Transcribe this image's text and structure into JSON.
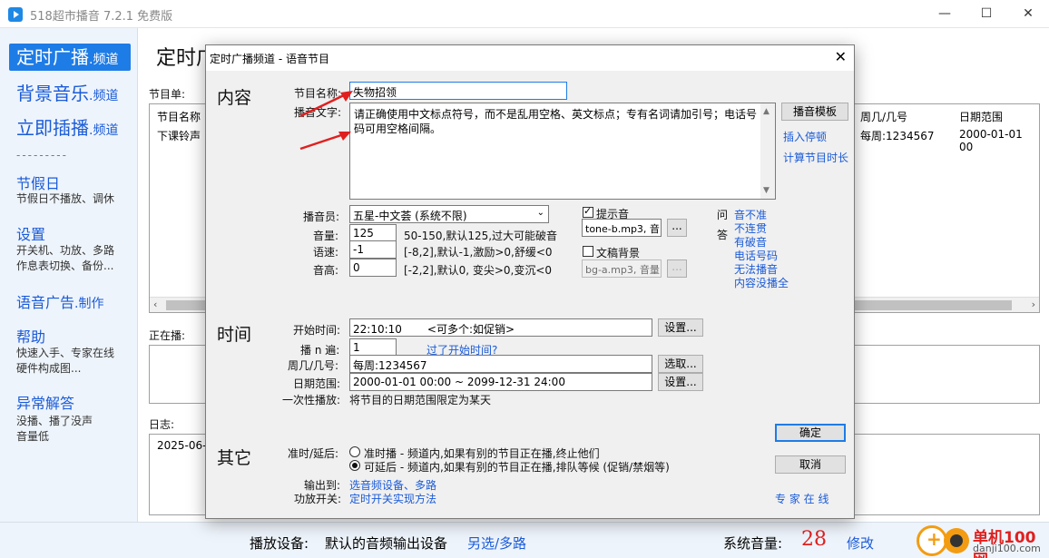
{
  "window": {
    "title": "518超市播音 7.2.1 免费版"
  },
  "sidebar": {
    "main_items": [
      {
        "label": "定时广播",
        "suffix": ".频道"
      },
      {
        "label": "背景音乐",
        "suffix": ".频道"
      },
      {
        "label": "立即插播",
        "suffix": ".频道"
      }
    ],
    "separator": "---------",
    "sections": [
      {
        "title": "节假日",
        "desc": [
          "节假日不播放、调休"
        ]
      },
      {
        "title": "设置",
        "desc": [
          "开关机、功放、多路",
          "作息表切换、备份..."
        ]
      },
      {
        "title": "语音广告",
        "title_suffix": ".制作",
        "desc": []
      },
      {
        "title": "帮助",
        "desc": [
          "快速入手、专家在线",
          "硬件构成图..."
        ]
      },
      {
        "title": "异常解答",
        "desc": [
          "没播、播了没声",
          "音量低"
        ]
      }
    ]
  },
  "main": {
    "page_title_partial": "定时广",
    "program_list_label": "节目单:",
    "columns": [
      "节目名称",
      "周几/几号",
      "日期范围"
    ],
    "row": {
      "name": "下课铃声",
      "weekday": "每周:1234567",
      "date_range": "2000-01-01 00"
    },
    "playing_label": "正在播:",
    "log_label": "日志:",
    "log_partial": "2025-06-"
  },
  "status_bar": {
    "device_label": "播放设备:",
    "device_value": "默认的音频输出设备",
    "device_link": "另选/多路",
    "volume_label": "系统音量:",
    "volume_value": "28",
    "modify_link": "修改"
  },
  "watermark": {
    "brand": "单机100网",
    "url": "danji100.com"
  },
  "dialog": {
    "title": "定时广播频道 - 语音节目",
    "close": "X",
    "section_content": "内容",
    "section_time": "时间",
    "section_other": "其它",
    "program_name_label": "节目名称:",
    "program_name_value": "失物招领",
    "text_label": "播音文字:",
    "text_value": "请正确使用中文标点符号，而不是乱用空格、英文标点；专有名词请加引号；电话号码可用空格间隔。",
    "template_button": "播音模板",
    "insert_pause_link": "插入停顿",
    "calc_duration_link": "计算节目时长",
    "announcer_label": "播音员:",
    "announcer_value": "五星-中文荟 (系统不限)",
    "volume_label": "音量:",
    "volume_value": "125",
    "volume_hint": "50-150,默认125,过大可能破音",
    "speed_label": "语速:",
    "speed_value": "-1",
    "speed_hint": "[-8,2],默认-1,激励>0,舒缓<0",
    "pitch_label": "音高:",
    "pitch_value": "0",
    "pitch_hint": "[-2,2],默认0, 变尖>0,变沉<0",
    "prompt_tone_label": "提示音",
    "prompt_tone_value": "tone-b.mp3, 音",
    "bg_label": "文稿背景",
    "bg_value": "bg-a.mp3, 音量",
    "dots": "...",
    "qa_label_1": "问",
    "qa_label_2": "答",
    "qa_links": [
      "音不准",
      "不连贯",
      "有破音",
      "电话号码",
      "无法播音",
      "内容没播全"
    ],
    "start_time_label": "开始时间:",
    "start_time_value": "22:10:10",
    "start_time_hint": "<可多个:如促销>",
    "settings_button": "设置...",
    "play_n_label": "播 n 遍:",
    "play_n_value": "1",
    "missed_start_link": "过了开始时间?",
    "weekday_label": "周几/几号:",
    "weekday_value": "每周:1234567",
    "select_button": "选取...",
    "date_range_label": "日期范围:",
    "date_range_value": "2000-01-01 00:00 ~ 2099-12-31 24:00",
    "once_label": "一次性播放:",
    "once_value": "将节目的日期范围限定为某天",
    "ok_button": "确定",
    "cancel_button": "取消",
    "timing_label": "准时/延后:",
    "radio_ontime": "准时播 - 频道内,如果有别的节目正在播,终止他们",
    "radio_delay": "可延后 - 频道内,如果有别的节目正在播,排队等候 (促销/禁烟等)",
    "output_label": "输出到:",
    "output_link": "选音频设备、多路",
    "amp_label": "功放开关:",
    "amp_link": "定时开关实现方法",
    "expert_link": "专 家 在 线"
  }
}
